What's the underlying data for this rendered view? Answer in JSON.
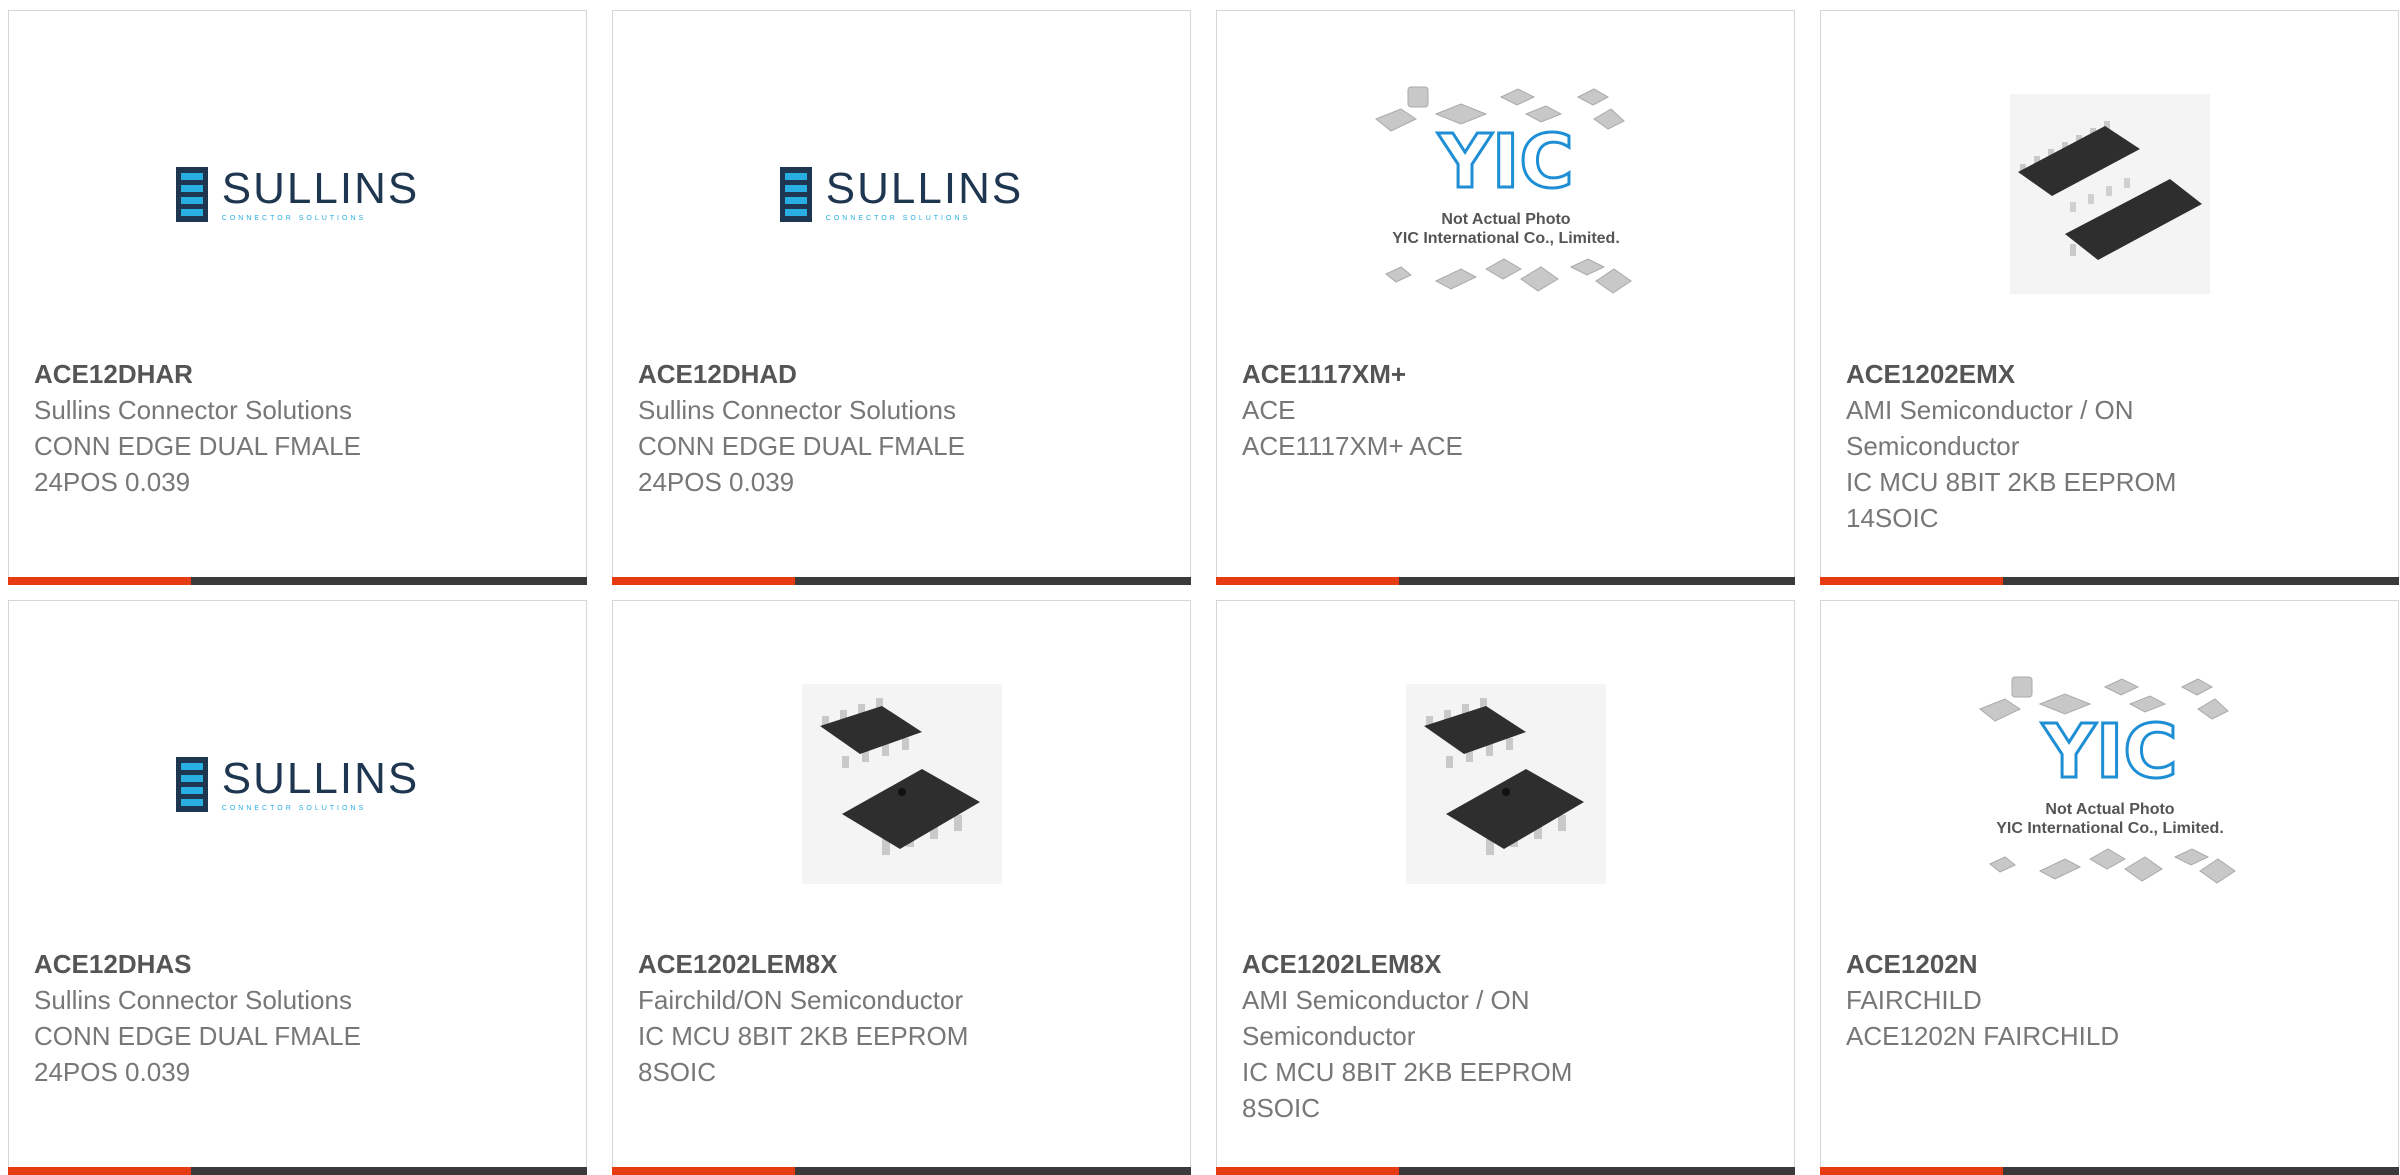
{
  "products": [
    {
      "part": "ACE12DHAR",
      "lines": [
        "Sullins Connector Solutions",
        "CONN EDGE DUAL FMALE",
        "24POS 0.039"
      ],
      "image": "sullins"
    },
    {
      "part": "ACE12DHAD",
      "lines": [
        "Sullins Connector Solutions",
        "CONN EDGE DUAL FMALE",
        "24POS 0.039"
      ],
      "image": "sullins"
    },
    {
      "part": "ACE1117XM+",
      "lines": [
        "ACE",
        "ACE1117XM+ ACE"
      ],
      "image": "yic"
    },
    {
      "part": "ACE1202EMX",
      "lines": [
        "AMI Semiconductor / ON",
        "Semiconductor",
        "IC MCU 8BIT 2KB EEPROM",
        "14SOIC"
      ],
      "image": "soic14"
    },
    {
      "part": "ACE12DHAS",
      "lines": [
        "Sullins Connector Solutions",
        "CONN EDGE DUAL FMALE",
        "24POS 0.039"
      ],
      "image": "sullins"
    },
    {
      "part": "ACE1202LEM8X",
      "lines": [
        "Fairchild/ON Semiconductor",
        "IC MCU 8BIT 2KB EEPROM",
        "8SOIC"
      ],
      "image": "soic8"
    },
    {
      "part": "ACE1202LEM8X",
      "lines": [
        "AMI Semiconductor / ON",
        "Semiconductor",
        "IC MCU 8BIT 2KB EEPROM",
        "8SOIC"
      ],
      "image": "soic8"
    },
    {
      "part": "ACE1202N",
      "lines": [
        "FAIRCHILD",
        "ACE1202N FAIRCHILD"
      ],
      "image": "yic"
    }
  ],
  "logos": {
    "sullins_name": "SULLINS",
    "sullins_sub": "CONNECTOR SOLUTIONS",
    "yic_mark": "YIC",
    "yic_line1": "Not Actual Photo",
    "yic_line2": "YIC International Co., Limited."
  },
  "colors": {
    "accent": "#e53a12",
    "bar": "#3a3a3a",
    "sullins_navy": "#1e3650",
    "sullins_blue": "#29aee3"
  }
}
